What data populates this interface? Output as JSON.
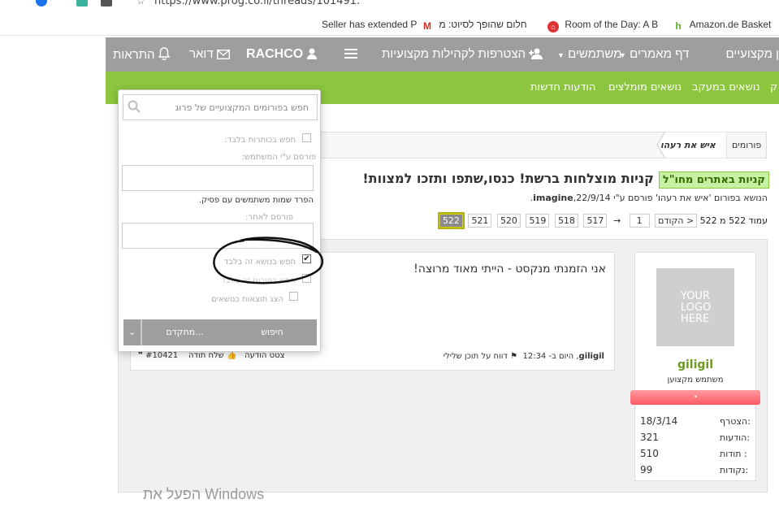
{
  "browser": {
    "url": "https://www.prog.co.il/threads/101491.",
    "bookmarks": [
      {
        "label": "Seller has extended P"
      },
      {
        "label": "חלום שהופך לסיוט: מ"
      },
      {
        "label": "Room of the Day: A B"
      },
      {
        "label": "Amazon.de Basket"
      }
    ]
  },
  "topnav": {
    "forums": "ן מקצועיים",
    "articles": "דף מאמרים",
    "users": "משתמשים",
    "join": "הצטרפות לקהילות מקצועיות",
    "user": "RACHCO",
    "mail": "דואר",
    "alerts": "התראות"
  },
  "subnav": {
    "new_posts": "הודעות חדשות",
    "recommended": "נושאים מומלצים",
    "followed": "נושאים במעקב",
    "edge": "ק"
  },
  "breadcrumb": {
    "forums": "פורומים",
    "section": "איש את רעהו"
  },
  "thread": {
    "prefix": "קניות באתרים מחו\"ל",
    "title": "קניות מוצלחות ברשת! כנסו,שתפו ותזכו למצוות!",
    "subtitle_pre": "הנושא בפורום 'איש את רעהו' פורסם ע\"י",
    "subtitle_user": "imagine",
    "subtitle_date": ",22/9/14."
  },
  "pager": {
    "label": "עמוד 522 מ 522",
    "prev": "< הקודם",
    "jump": "1",
    "arrow": "→",
    "pages": [
      "517",
      "518",
      "519",
      "520",
      "521",
      "522"
    ],
    "current": "522"
  },
  "post": {
    "text": "אני הזמנתי מנקסט - הייתי מאוד מרוצה!",
    "author": "giligil",
    "time": ", היום ב- 12:34",
    "report": "דווח על תוכן שלילי",
    "number": "#10421",
    "thanks": "שלח תודה",
    "quote": "צטט הודעה"
  },
  "user_card": {
    "logo": [
      "YOUR",
      "LOGO",
      "HERE"
    ],
    "name": "giligil",
    "title": "משתמש מקצוען",
    "stats": [
      {
        "label": "הצטרף:",
        "value": "18/3/14"
      },
      {
        "label": "הודעות:",
        "value": "321"
      },
      {
        "label": "תודות :",
        "value": "510"
      },
      {
        "label": "נקודות:",
        "value": "99"
      }
    ]
  },
  "search": {
    "placeholder": "חפש בפורומים המקצועיים של פרוג",
    "titles_only": "חפש בכותרות בלבד:",
    "posted_by_label": "פורסם ע\"י המשתמש:",
    "posted_by_hint": "הפרד שמות משתמשים עם פסיק.",
    "newer_than": "פורסם לאחר:",
    "this_thread": "חפש בנושא זה בלבד",
    "this_forum": "חפש בפורום זה בלבד",
    "show_as_threads": "הצג תוצאות כנושאים",
    "search_btn": "חיפוש",
    "advanced_btn": "מתקדם...",
    "this_thread_checked": true
  },
  "watermark": "הפעל את Windows",
  "colors": {
    "nav": "#9e9e9e",
    "green": "#8cc63f",
    "username": "#6c9a1f",
    "bar": "#ff5a62"
  }
}
